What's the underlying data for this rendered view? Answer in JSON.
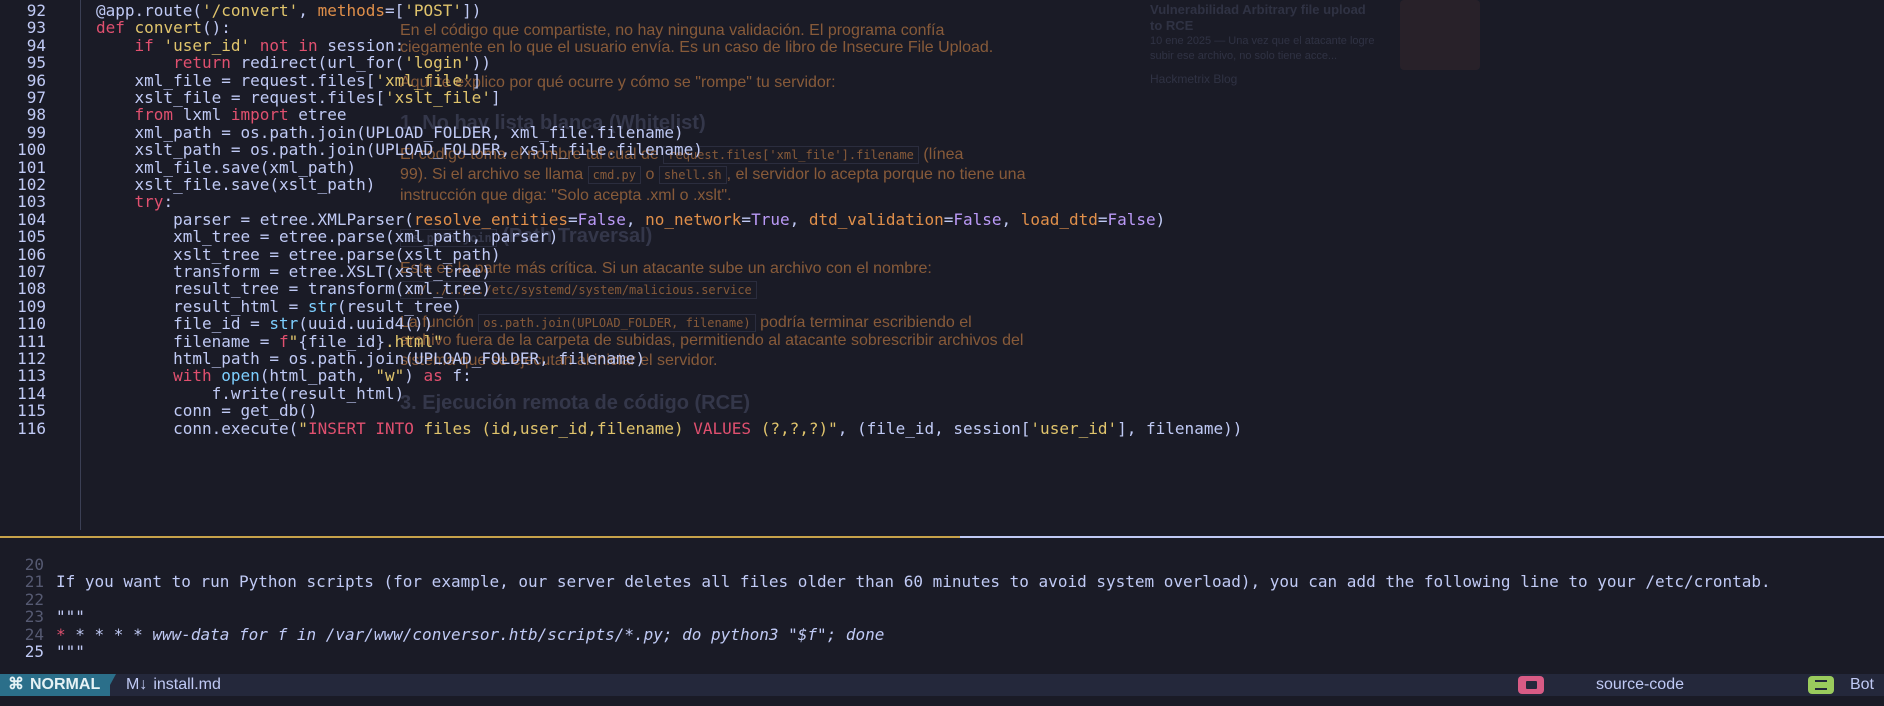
{
  "background": {
    "article": {
      "p1": "En el código que compartiste, no hay ninguna validación. El programa confía",
      "p2": "ciegamente en lo que el usuario envía. Es un caso de libro de Insecure File Upload.",
      "p3": "Aquí te explico por qué ocurre y cómo se \"rompe\" tu servidor:",
      "h1": "1. No hay lista blanca (Whitelist)",
      "p4a": "El código toma el nombre tal cual de",
      "p4code": "request.files['xml_file'].filename",
      "p4b": "(línea",
      "p5a": "99). Si el archivo se llama",
      "p5code1": "cmd.py",
      "p5o": "o",
      "p5code2": "shell.sh",
      "p5b": ", el servidor lo acepta porque no tiene una",
      "p6": "instrucción que diga: \"Solo acepta .xml o .xslt\".",
      "h2code": "os.path.join",
      "h2": "(Path Traversal)",
      "p7": "Esta es la parte más crítica. Si un atacante sube un archivo con el nombre:",
      "p8code": "../../../../etc/systemd/system/malicious.service",
      "p9a": "La función",
      "p9code": "os.path.join(UPLOAD_FOLDER, filename)",
      "p9b": "podría terminar escribiendo el",
      "p10": "archivo fuera de la carpeta de subidas, permitiendo al atacante sobrescribir archivos del",
      "p11": "sistema que se ejecutan al iniciar el servidor.",
      "h3": "3. Ejecución remota de código (RCE)"
    },
    "card": {
      "title": "Vulnerabilidad Arbitrary file upload to RCE",
      "snippet": "10 ene 2025 — Una vez que el atacante logre subir ese archivo, no solo tiene acce...",
      "source": "Hackmetrix Blog"
    }
  },
  "editor": {
    "code_lines": [
      {
        "n": "92",
        "html": "<span>@app.route(</span><span class=\"s\">'/convert'</span><span>, </span><span class=\"p\">methods</span><span>=[</span><span class=\"s\">'POST'</span><span>])</span>"
      },
      {
        "n": "93",
        "html": "<span class=\"d\">def</span> <span class=\"fn\">convert</span><span>():</span>"
      },
      {
        "n": "94",
        "html": "    <span class=\"k\">if</span> <span class=\"s\">'user_id'</span> <span class=\"k\">not in</span> session:"
      },
      {
        "n": "95",
        "html": "        <span class=\"k\">return</span> redirect(url_for(<span class=\"s\">'login'</span>))"
      },
      {
        "n": "96",
        "html": "    xml_file = request.files[<span class=\"s\">'xml_file'</span>]"
      },
      {
        "n": "97",
        "html": "    xslt_file = request.files[<span class=\"s\">'xslt_file'</span>]"
      },
      {
        "n": "98",
        "html": "    <span class=\"k\">from</span> lxml <span class=\"k\">import</span> etree"
      },
      {
        "n": "99",
        "html": "    xml_path = os.path.join(UPLOAD_FOLDER, xml_file.filename)"
      },
      {
        "n": "100",
        "html": "    xslt_path = os.path.join(UPLOAD_FOLDER, xslt_file.filename)"
      },
      {
        "n": "101",
        "html": "    xml_file.save(xml_path)"
      },
      {
        "n": "102",
        "html": "    xslt_file.save(xslt_path)"
      },
      {
        "n": "103",
        "html": "    <span class=\"k\">try</span>:"
      },
      {
        "n": "104",
        "html": "        parser = etree.XMLParser(<span class=\"p\">resolve_entities</span>=<span class=\"c\">False</span>, <span class=\"p\">no_network</span>=<span class=\"c\">True</span>, <span class=\"p\">dtd_validation</span>=<span class=\"c\">False</span>, <span class=\"p\">load_dtd</span>=<span class=\"c\">False</span>)"
      },
      {
        "n": "105",
        "html": "        xml_tree = etree.parse(xml_path, parser)"
      },
      {
        "n": "106",
        "html": "        xslt_tree = etree.parse(xslt_path)"
      },
      {
        "n": "107",
        "html": "        transform = etree.XSLT(xslt_tree)"
      },
      {
        "n": "108",
        "html": "        result_tree = transform(xml_tree)"
      },
      {
        "n": "109",
        "html": "        result_html = <span class=\"bi\">str</span>(result_tree)"
      },
      {
        "n": "110",
        "html": "        file_id = <span class=\"bi\">str</span>(uuid.uuid4())"
      },
      {
        "n": "111",
        "html": "        filename = <span class=\"k\">f</span><span class=\"s\">\"</span>{file_id}<span class=\"s\">.html\"</span>"
      },
      {
        "n": "112",
        "html": "        html_path = os.path.join(UPLOAD_FOLDER, filename)"
      },
      {
        "n": "113",
        "html": "        <span class=\"k\">with</span> <span class=\"bi\">open</span>(html_path, <span class=\"s\">\"w\"</span>) <span class=\"k\">as</span> f:"
      },
      {
        "n": "114",
        "html": "            f.write(result_html)"
      },
      {
        "n": "115",
        "html": "        conn = get_db()"
      },
      {
        "n": "116",
        "html": "        conn.execute(<span class=\"s\">\"</span><span class=\"k\">INSERT INTO</span><span class=\"s\"> files (id,user_id,filename) </span><span class=\"k\">VALUES</span><span class=\"s\"> (?,?,?)\"</span>, (file_id, session[<span class=\"s\">'user_id'</span>], filename))"
      }
    ]
  },
  "markdown": {
    "lines": [
      {
        "n": "20",
        "text": ""
      },
      {
        "n": "21",
        "text": "If you want to run Python scripts (for example, our server deletes all files older than 60 minutes to avoid system overload), you can add the following line to your /etc/crontab."
      },
      {
        "n": "22",
        "text": ""
      },
      {
        "n": "23",
        "text": "\"\"\""
      },
      {
        "n": "24",
        "star": "*",
        "text": " * * * * www-data for f in /var/www/conversor.htb/scripts/*.py; do python3 \"$f\"; done"
      },
      {
        "n": "25",
        "text": "\"\"\"",
        "current": true
      }
    ]
  },
  "statusline": {
    "mode": "NORMAL",
    "mode_icon": "vim-icon",
    "file_icon": "markdown-icon",
    "filename": "install.md",
    "filetype": "source-code",
    "position": "Bot",
    "colors": {
      "mode_bg": "#2b6f8a",
      "filetype_icon": "#d85b85",
      "position_icon": "#9acb5d"
    }
  }
}
